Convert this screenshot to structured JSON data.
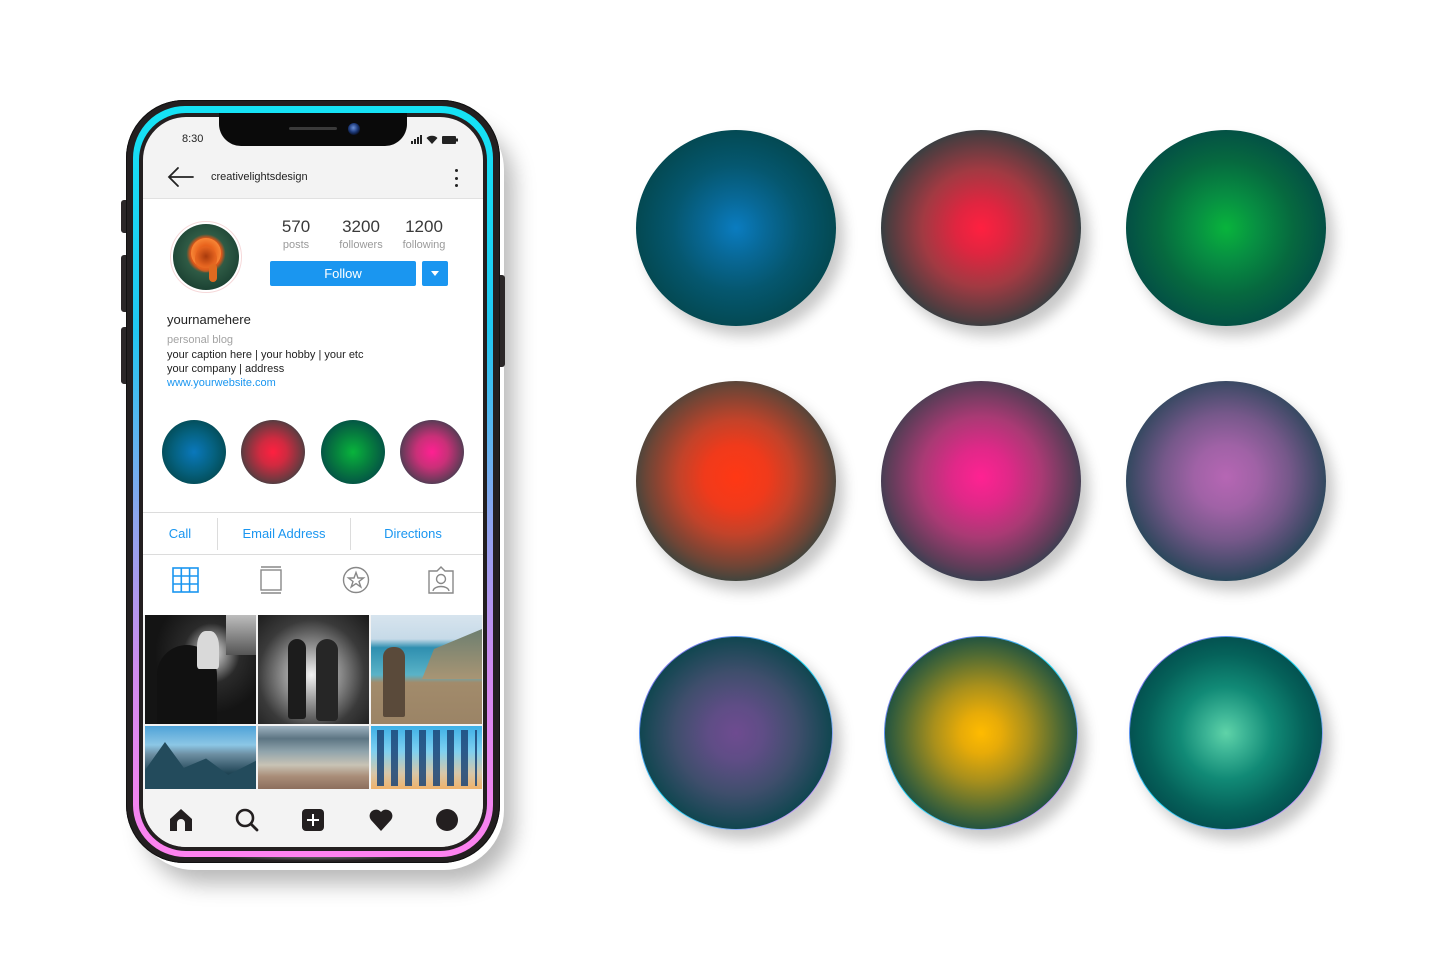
{
  "phone": {
    "status_bar": {
      "time": "8:30",
      "icons": [
        "signal-icon",
        "wifi-icon",
        "battery-icon"
      ]
    },
    "header": {
      "back_icon": "arrow-left-icon",
      "username": "creativelightsdesign",
      "more_icon": "more-vertical-icon"
    },
    "profile": {
      "avatar": "rose-photo",
      "stats": [
        {
          "value": "570",
          "label": "posts"
        },
        {
          "value": "3200",
          "label": "followers"
        },
        {
          "value": "1200",
          "label": "following"
        }
      ],
      "follow_label": "Follow",
      "dropdown_icon": "caret-down-icon",
      "name": "yournamehere",
      "category": "personal blog",
      "bio_lines": [
        "your caption here  | your hobby | your etc",
        "your company | address"
      ],
      "website": "www.yourwebsite.com"
    },
    "highlights": [
      {
        "name": "blue",
        "color": "#0a76b8"
      },
      {
        "name": "red",
        "color": "#ff2040"
      },
      {
        "name": "green",
        "color": "#08b43c"
      },
      {
        "name": "pink",
        "color": "#ff2090"
      }
    ],
    "actions": [
      "Call",
      "Email Address",
      "Directions"
    ],
    "tabs": [
      {
        "name": "grid",
        "icon": "grid-icon",
        "active": true
      },
      {
        "name": "feed",
        "icon": "feed-icon",
        "active": false
      },
      {
        "name": "saved",
        "icon": "star-circle-icon",
        "active": false
      },
      {
        "name": "tagged",
        "icon": "tagged-user-icon",
        "active": false
      }
    ],
    "posts": [
      "bw-couple-embrace",
      "bw-couple-in-rain",
      "photographer-on-cliff",
      "mountain-valley",
      "beach-shore",
      "people-jumping-silhouettes"
    ],
    "bottom_nav": [
      "home-icon",
      "search-icon",
      "add-post-icon",
      "heart-icon",
      "profile-icon"
    ],
    "colors": {
      "accent": "#1a96f0",
      "frame_top": "#15e3f5",
      "frame_bottom": "#ff82f0"
    }
  },
  "orbs": [
    {
      "name": "blue",
      "center": "#0a7cc0"
    },
    {
      "name": "red",
      "center": "#ff2040"
    },
    {
      "name": "green",
      "center": "#08b43c"
    },
    {
      "name": "orange-red",
      "center": "#ff3814"
    },
    {
      "name": "magenta",
      "center": "#ff2292"
    },
    {
      "name": "violet",
      "center": "#b666b4"
    },
    {
      "name": "purple",
      "center": "#6e4b90"
    },
    {
      "name": "gold",
      "center": "#ffbb00"
    },
    {
      "name": "mint",
      "center": "#5fd3a8"
    }
  ],
  "orb_base": "#034448"
}
